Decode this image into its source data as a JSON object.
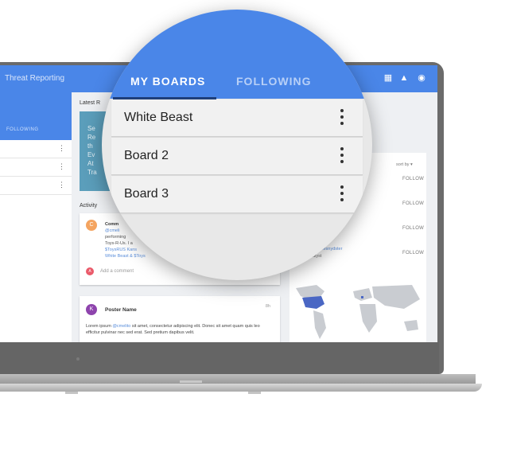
{
  "app": {
    "title": "Threat Reporting"
  },
  "toolbar": {
    "icons": [
      "apps-icon",
      "bell-icon",
      "account-icon"
    ]
  },
  "left_panel": {
    "tab_label": "FOLLOWING",
    "row_count": 3
  },
  "main": {
    "latest_title": "Latest R",
    "feature_lines": [
      "Se",
      "Re",
      "th",
      "Ev",
      "At",
      "Tra"
    ],
    "activity_label": "Activity",
    "comment_card": {
      "avatar_letter": "C",
      "lines": [
        "Comm",
        "@cmeli",
        "performing",
        "Toys-R-Us. I a",
        "$ToysRUS Kans",
        "White Beast & $Toys"
      ],
      "add_comment_avatar": "A",
      "add_comment_placeholder": "Add a comment"
    },
    "post_card": {
      "avatar_letter": "K",
      "author": "Poster Name",
      "time": "8h",
      "body_prefix": "Lorem ipsum ",
      "mention": "@cmelito",
      "body_suffix": " sit amet, consectetur adipiscing elit. Donec sit amet quam quis leo efficitur pulvinar nec sed erat. Sed pretium dapibus velit."
    }
  },
  "right_panel": {
    "sort_label": "sort by",
    "follow_labels": [
      "FOLLOW",
      "FOLLOW",
      "FOLLOW",
      "FOLLOW"
    ],
    "user_line_prefix": "er ",
    "user_handle": "@thesnydster",
    "user_role": "nalyst"
  },
  "magnifier": {
    "tabs": [
      {
        "label": "MY BOARDS",
        "active": true
      },
      {
        "label": "FOLLOWING",
        "active": false
      }
    ],
    "boards": [
      {
        "name": "White Beast"
      },
      {
        "name": "Board 2"
      },
      {
        "name": "Board 3"
      }
    ]
  },
  "colors": {
    "primary": "#4a86e8",
    "feature": "#5b9ebb",
    "laptop": "#6b6b6b",
    "map_highlight": "#4a67c4"
  }
}
